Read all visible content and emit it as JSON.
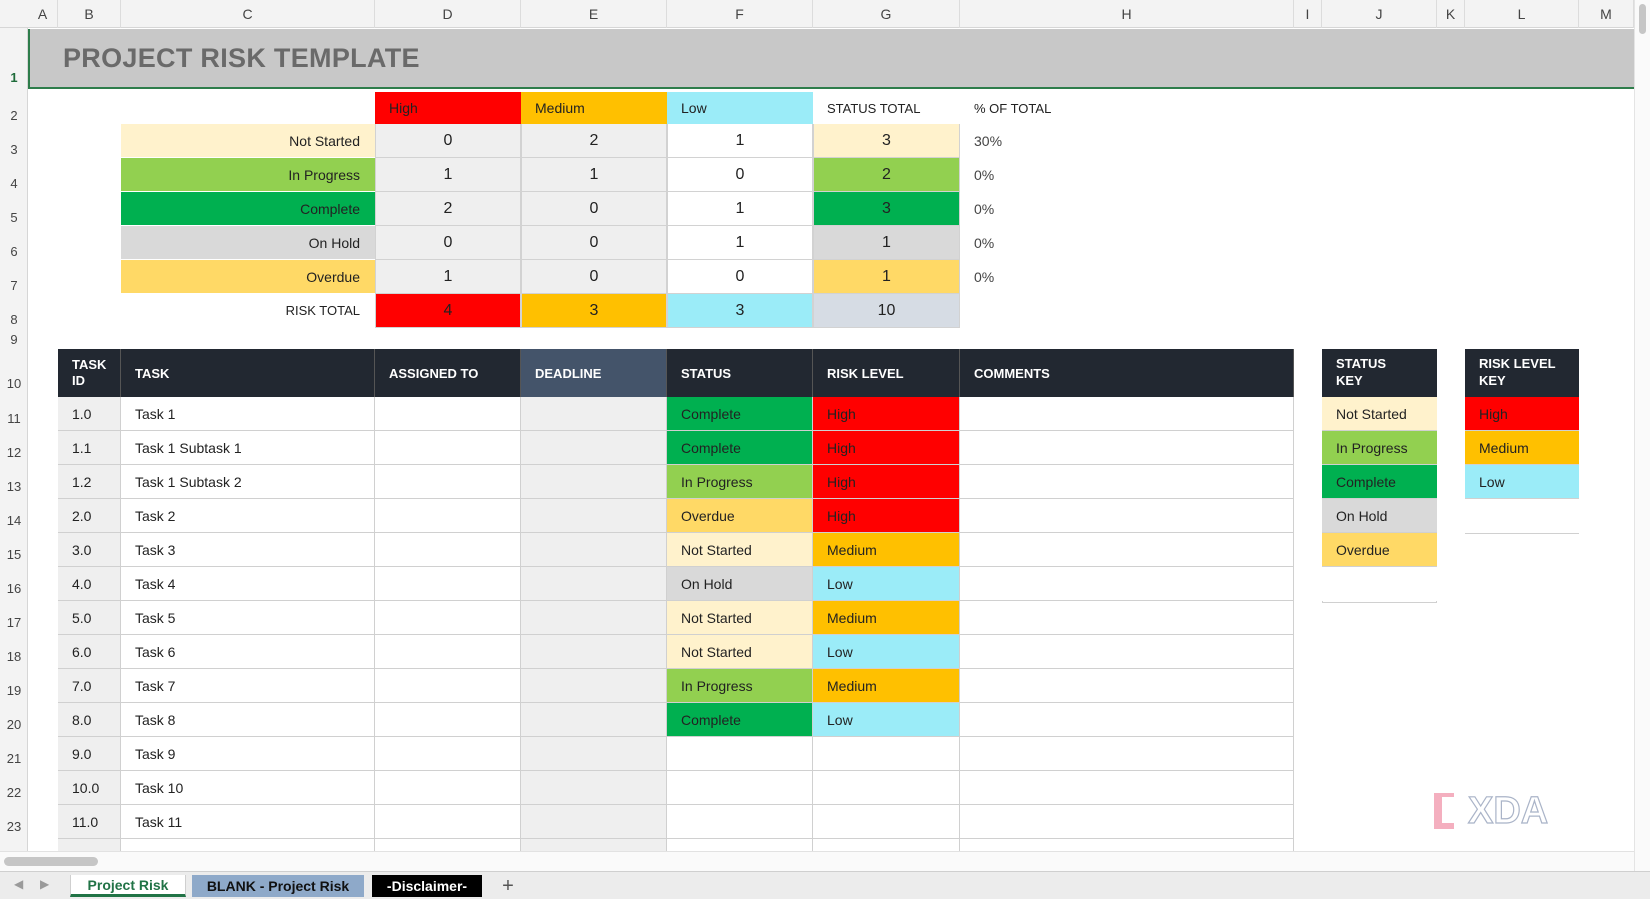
{
  "columns": [
    "A",
    "B",
    "C",
    "D",
    "E",
    "F",
    "G",
    "H",
    "I",
    "J",
    "K",
    "L",
    "M"
  ],
  "rows": [
    "1",
    "2",
    "3",
    "4",
    "5",
    "6",
    "7",
    "8",
    "9",
    "10",
    "11",
    "12",
    "13",
    "14",
    "15",
    "16",
    "17",
    "18",
    "19",
    "20",
    "21",
    "22",
    "23"
  ],
  "title": "PROJECT RISK TEMPLATE",
  "colors": {
    "high": "#ff0000",
    "medium": "#ffc000",
    "low": "#9becf8",
    "not_started": "#fff2cc",
    "in_progress": "#92d050",
    "complete": "#00b050",
    "on_hold": "#d9d9d9",
    "overdue": "#ffd966",
    "header_dark": "#222831",
    "deadline_header": "#44546a",
    "title_band": "#c8c8c8"
  },
  "summary": {
    "headers": {
      "high": "High",
      "medium": "Medium",
      "low": "Low",
      "status_total": "STATUS TOTAL",
      "pct_total": "% OF TOTAL"
    },
    "rows": [
      {
        "label": "Not Started",
        "high": "0",
        "medium": "2",
        "low": "1",
        "total": "3",
        "pct": "30%"
      },
      {
        "label": "In Progress",
        "high": "1",
        "medium": "1",
        "low": "0",
        "total": "2",
        "pct": "0%"
      },
      {
        "label": "Complete",
        "high": "2",
        "medium": "0",
        "low": "1",
        "total": "3",
        "pct": "0%"
      },
      {
        "label": "On Hold",
        "high": "0",
        "medium": "0",
        "low": "1",
        "total": "1",
        "pct": "0%"
      },
      {
        "label": "Overdue",
        "high": "1",
        "medium": "0",
        "low": "0",
        "total": "1",
        "pct": "0%"
      }
    ],
    "risk_total": {
      "label": "RISK TOTAL",
      "high": "4",
      "medium": "3",
      "low": "3",
      "total": "10"
    }
  },
  "tasks": {
    "headers": {
      "id_line1": "TASK",
      "id_line2": "ID",
      "task": "TASK",
      "assigned": "ASSIGNED TO",
      "deadline": "DEADLINE",
      "status": "STATUS",
      "risk": "RISK LEVEL",
      "comments": "COMMENTS"
    },
    "rows": [
      {
        "id": "1.0",
        "task": "Task 1",
        "status": "Complete",
        "risk": "High"
      },
      {
        "id": "1.1",
        "task": "Task 1 Subtask 1",
        "status": "Complete",
        "risk": "High"
      },
      {
        "id": "1.2",
        "task": "Task 1 Subtask 2",
        "status": "In Progress",
        "risk": "High"
      },
      {
        "id": "2.0",
        "task": "Task 2",
        "status": "Overdue",
        "risk": "High"
      },
      {
        "id": "3.0",
        "task": "Task 3",
        "status": "Not Started",
        "risk": "Medium"
      },
      {
        "id": "4.0",
        "task": "Task 4",
        "status": "On Hold",
        "risk": "Low"
      },
      {
        "id": "5.0",
        "task": "Task 5",
        "status": "Not Started",
        "risk": "Medium"
      },
      {
        "id": "6.0",
        "task": "Task 6",
        "status": "Not Started",
        "risk": "Low"
      },
      {
        "id": "7.0",
        "task": "Task 7",
        "status": "In Progress",
        "risk": "Medium"
      },
      {
        "id": "8.0",
        "task": "Task 8",
        "status": "Complete",
        "risk": "Low"
      },
      {
        "id": "9.0",
        "task": "Task 9",
        "status": "",
        "risk": ""
      },
      {
        "id": "10.0",
        "task": "Task 10",
        "status": "",
        "risk": ""
      },
      {
        "id": "11.0",
        "task": "Task 11",
        "status": "",
        "risk": ""
      }
    ]
  },
  "status_key": {
    "title_line1": "STATUS",
    "title_line2": "KEY",
    "items": [
      "Not Started",
      "In Progress",
      "Complete",
      "On Hold",
      "Overdue"
    ]
  },
  "risk_key": {
    "title_line1": "RISK LEVEL",
    "title_line2": "KEY",
    "items": [
      "High",
      "Medium",
      "Low"
    ]
  },
  "sheet_tabs": [
    {
      "label": "Project Risk",
      "active": true
    },
    {
      "label": "BLANK - Project Risk",
      "active": false
    },
    {
      "label": "-Disclaimer-",
      "active": false
    }
  ],
  "add_sheet_label": "+",
  "watermark": "XDA"
}
